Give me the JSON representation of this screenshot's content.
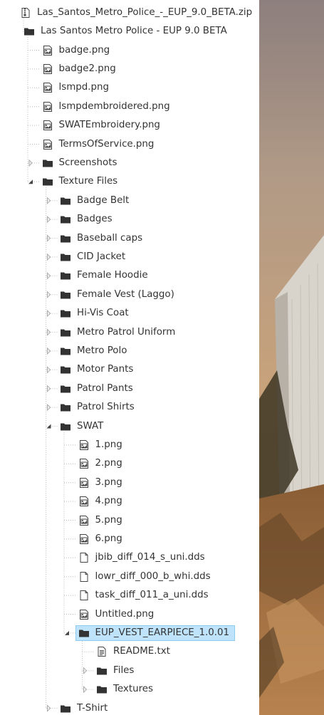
{
  "tree": [
    {
      "label": "Las_Santos_Metro_Police_-_EUP_9.0_BETA.zip",
      "icon": "zip-file-icon",
      "depth": 0,
      "expanded": null
    },
    {
      "label": "Las Santos Metro Police - EUP 9.0 BETA",
      "icon": "folder-icon",
      "depth": 1,
      "expanded": true
    },
    {
      "label": "badge.png",
      "icon": "image-file-icon",
      "depth": 2
    },
    {
      "label": "badge2.png",
      "icon": "image-file-icon",
      "depth": 2
    },
    {
      "label": "lsmpd.png",
      "icon": "image-file-icon",
      "depth": 2
    },
    {
      "label": "lsmpdembroidered.png",
      "icon": "image-file-icon",
      "depth": 2
    },
    {
      "label": "SWATEmbroidery.png",
      "icon": "image-file-icon",
      "depth": 2
    },
    {
      "label": "TermsOfService.png",
      "icon": "image-file-icon",
      "depth": 2
    },
    {
      "label": "Screenshots",
      "icon": "folder-icon",
      "depth": 2,
      "expanded": false
    },
    {
      "label": "Texture Files",
      "icon": "folder-icon",
      "depth": 2,
      "expanded": true
    },
    {
      "label": "Badge Belt",
      "icon": "folder-icon",
      "depth": 3,
      "expanded": false
    },
    {
      "label": "Badges",
      "icon": "folder-icon",
      "depth": 3,
      "expanded": false
    },
    {
      "label": "Baseball caps",
      "icon": "folder-icon",
      "depth": 3,
      "expanded": false
    },
    {
      "label": "CID Jacket",
      "icon": "folder-icon",
      "depth": 3,
      "expanded": false
    },
    {
      "label": "Female Hoodie",
      "icon": "folder-icon",
      "depth": 3,
      "expanded": false
    },
    {
      "label": "Female Vest (Laggo)",
      "icon": "folder-icon",
      "depth": 3,
      "expanded": false
    },
    {
      "label": "Hi-Vis Coat",
      "icon": "folder-icon",
      "depth": 3,
      "expanded": false
    },
    {
      "label": "Metro Patrol Uniform",
      "icon": "folder-icon",
      "depth": 3,
      "expanded": false
    },
    {
      "label": "Metro Polo",
      "icon": "folder-icon",
      "depth": 3,
      "expanded": false
    },
    {
      "label": "Motor Pants",
      "icon": "folder-icon",
      "depth": 3,
      "expanded": false
    },
    {
      "label": "Patrol Pants",
      "icon": "folder-icon",
      "depth": 3,
      "expanded": false
    },
    {
      "label": "Patrol Shirts",
      "icon": "folder-icon",
      "depth": 3,
      "expanded": false
    },
    {
      "label": "SWAT",
      "icon": "folder-icon",
      "depth": 3,
      "expanded": true
    },
    {
      "label": "1.png",
      "icon": "image-file-icon",
      "depth": 4
    },
    {
      "label": "2.png",
      "icon": "image-file-icon",
      "depth": 4
    },
    {
      "label": "3.png",
      "icon": "image-file-icon",
      "depth": 4
    },
    {
      "label": "4.png",
      "icon": "image-file-icon",
      "depth": 4
    },
    {
      "label": "5.png",
      "icon": "image-file-icon",
      "depth": 4
    },
    {
      "label": "6.png",
      "icon": "image-file-icon",
      "depth": 4
    },
    {
      "label": "jbib_diff_014_s_uni.dds",
      "icon": "blank-file-icon",
      "depth": 4
    },
    {
      "label": "lowr_diff_000_b_whi.dds",
      "icon": "blank-file-icon",
      "depth": 4
    },
    {
      "label": "task_diff_011_a_uni.dds",
      "icon": "blank-file-icon",
      "depth": 4
    },
    {
      "label": "Untitled.png",
      "icon": "image-file-icon",
      "depth": 4
    },
    {
      "label": "EUP_VEST_EARPIECE_1.0.01",
      "icon": "folder-icon",
      "depth": 4,
      "expanded": true,
      "selected": true
    },
    {
      "label": "README.txt",
      "icon": "text-file-icon",
      "depth": 5
    },
    {
      "label": "Files",
      "icon": "folder-icon",
      "depth": 5,
      "expanded": false
    },
    {
      "label": "Textures",
      "icon": "folder-icon",
      "depth": 5,
      "expanded": false
    },
    {
      "label": "T-Shirt",
      "icon": "folder-icon",
      "depth": 3,
      "expanded": false
    }
  ],
  "colors": {
    "selection_bg": "#bfe3fb",
    "selection_border": "#8fcaf0",
    "folder": "#333333",
    "guide": "#bbbbbb"
  }
}
